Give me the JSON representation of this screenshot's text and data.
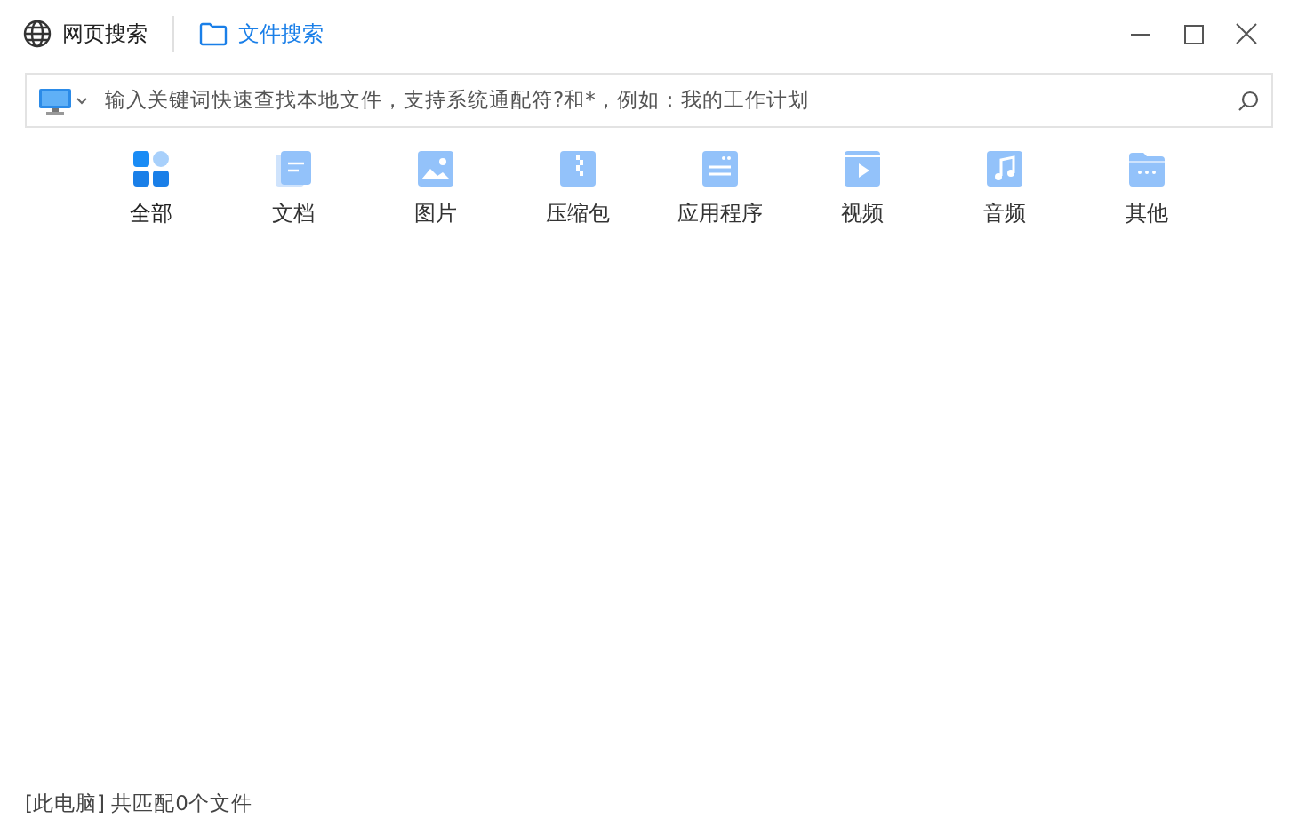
{
  "tabs": [
    {
      "label": "网页搜索",
      "kind": "web",
      "selected": false
    },
    {
      "label": "文件搜索",
      "kind": "file",
      "selected": true
    }
  ],
  "search": {
    "placeholder": "输入关键词快速查找本地文件，支持系统通配符?和*，例如：我的工作计划"
  },
  "categories": [
    {
      "label": "全部",
      "kind": "all",
      "selected": true
    },
    {
      "label": "文档",
      "kind": "doc",
      "selected": false
    },
    {
      "label": "图片",
      "kind": "image",
      "selected": false
    },
    {
      "label": "压缩包",
      "kind": "zip",
      "selected": false
    },
    {
      "label": "应用程序",
      "kind": "app",
      "selected": false
    },
    {
      "label": "视频",
      "kind": "video",
      "selected": false
    },
    {
      "label": "音频",
      "kind": "audio",
      "selected": false
    },
    {
      "label": "其他",
      "kind": "other",
      "selected": false
    }
  ],
  "status_bar": "[此电脑] 共匹配0个文件"
}
